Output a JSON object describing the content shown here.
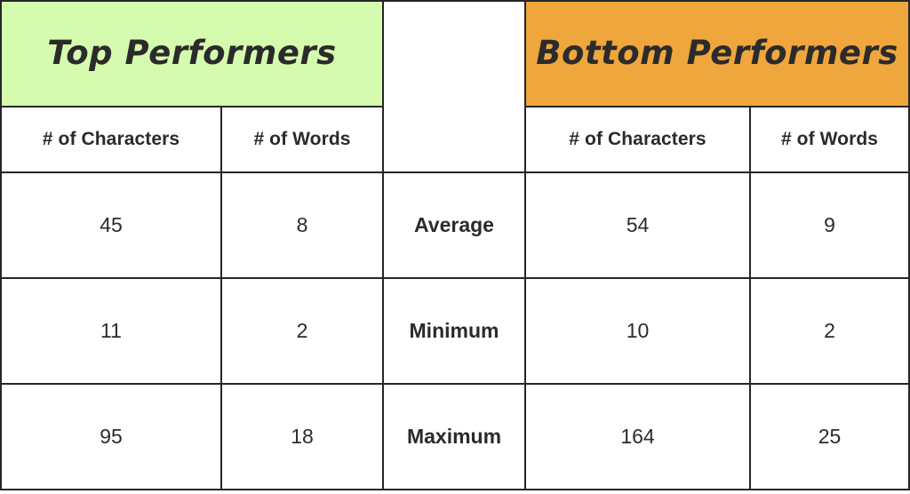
{
  "table": {
    "groups": {
      "left": {
        "label": "Top Performers",
        "color": "#d5fcae"
      },
      "middle": {
        "label": ""
      },
      "right": {
        "label": "Bottom Performers",
        "color": "#efa63c"
      }
    },
    "columns": [
      {
        "key": "left_chars",
        "label": "# of Characters"
      },
      {
        "key": "left_words",
        "label": "# of Words"
      },
      {
        "key": "metric",
        "label": ""
      },
      {
        "key": "right_chars",
        "label": "# of Characters"
      },
      {
        "key": "right_words",
        "label": "# of Words"
      }
    ],
    "rows": [
      {
        "metric": "Average",
        "left_chars": "45",
        "left_words": "8",
        "right_chars": "54",
        "right_words": "9"
      },
      {
        "metric": "Minimum",
        "left_chars": "11",
        "left_words": "2",
        "right_chars": "10",
        "right_words": "2"
      },
      {
        "metric": "Maximum",
        "left_chars": "95",
        "left_words": "18",
        "right_chars": "164",
        "right_words": "25"
      }
    ]
  },
  "chart_data": {
    "type": "table",
    "title": "",
    "column_groups": [
      "Top Performers",
      "",
      "Bottom Performers"
    ],
    "categories": [
      "Average",
      "Minimum",
      "Maximum"
    ],
    "series": [
      {
        "name": "Top Performers – # of Characters",
        "values": [
          45,
          11,
          95
        ]
      },
      {
        "name": "Top Performers – # of Words",
        "values": [
          8,
          2,
          18
        ]
      },
      {
        "name": "Bottom Performers – # of Characters",
        "values": [
          54,
          10,
          164
        ]
      },
      {
        "name": "Bottom Performers – # of Words",
        "values": [
          9,
          2,
          25
        ]
      }
    ],
    "xlabel": "",
    "ylabel": ""
  }
}
